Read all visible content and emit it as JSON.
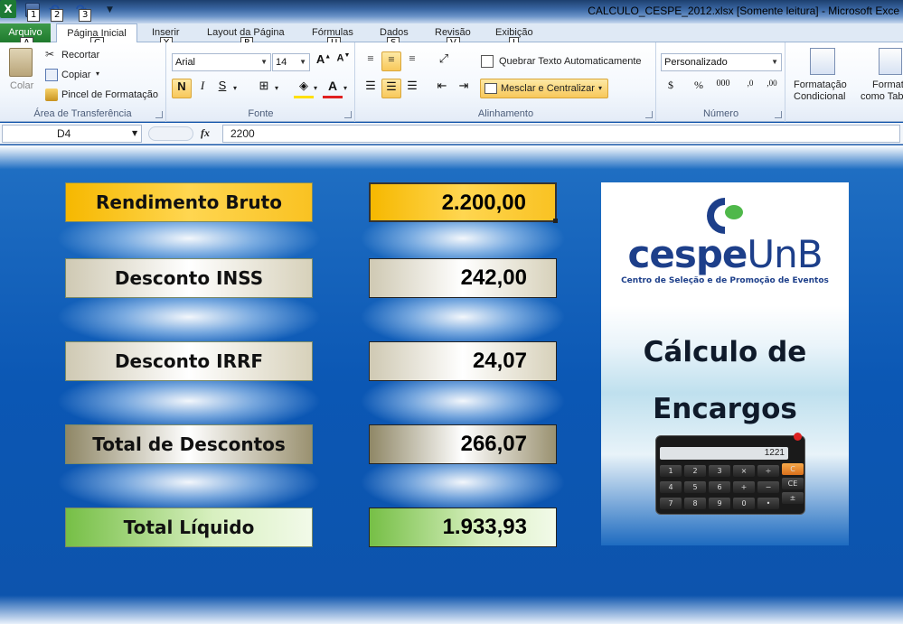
{
  "titlebar": {
    "app_icon_letter": "X",
    "keytips": [
      "1",
      "2",
      "3"
    ],
    "title": "CALCULO_CESPE_2012.xlsx  [Somente leitura]  -  Microsoft Exce"
  },
  "tabs": [
    {
      "label": "Arquivo",
      "keytip": "A"
    },
    {
      "label": "Página Inicial",
      "keytip": "C"
    },
    {
      "label": "Inserir",
      "keytip": "Y"
    },
    {
      "label": "Layout da Página",
      "keytip": "P"
    },
    {
      "label": "Fórmulas",
      "keytip": "U"
    },
    {
      "label": "Dados",
      "keytip": "S"
    },
    {
      "label": "Revisão",
      "keytip": "V"
    },
    {
      "label": "Exibição",
      "keytip": "J"
    }
  ],
  "ribbon": {
    "clipboard": {
      "paste": "Colar",
      "cut": "Recortar",
      "copy": "Copiar",
      "format_painter": "Pincel de Formatação",
      "group": "Área de Transferência"
    },
    "font": {
      "name": "Arial",
      "size": "14",
      "bold": "N",
      "italic": "I",
      "underline": "S",
      "group": "Fonte"
    },
    "alignment": {
      "wrap": "Quebrar Texto Automaticamente",
      "merge": "Mesclar e Centralizar",
      "group": "Alinhamento"
    },
    "number": {
      "format": "Personalizado",
      "group": "Número"
    },
    "styles": {
      "conditional_1": "Formatação",
      "conditional_2": "Condicional",
      "table_1": "Format",
      "table_2": "como Tab"
    }
  },
  "formula_bar": {
    "name_box": "D4",
    "fx": "fx",
    "value": "2200"
  },
  "sheet": {
    "rows": [
      {
        "label": "Rendimento Bruto",
        "value": "2.200,00"
      },
      {
        "label": "Desconto INSS",
        "value": "242,00"
      },
      {
        "label": "Desconto IRRF",
        "value": "24,07"
      },
      {
        "label": "Total de Descontos",
        "value": "266,07"
      },
      {
        "label": "Total Líquido",
        "value": "1.933,93"
      }
    ],
    "card": {
      "logo_bold": "cespe",
      "logo_light": "UnB",
      "logo_subtitle": "Centro de Seleção e de Promoção de Eventos",
      "title_line1": "Cálculo de",
      "title_line2": "Encargos",
      "calculator_display": "1221",
      "calculator_keys": [
        "1",
        "2",
        "3",
        "×",
        "÷",
        "C",
        "4",
        "5",
        "6",
        "+",
        "−",
        "CE",
        "7",
        "8",
        "9",
        "0",
        "•",
        "±"
      ]
    }
  },
  "colors": {
    "sheet_bg": "#0b57b4",
    "excel_green": "#1f7a2d",
    "gold": "#f6b800",
    "green": "#76bf46",
    "cespe_blue": "#1d3f8a"
  }
}
